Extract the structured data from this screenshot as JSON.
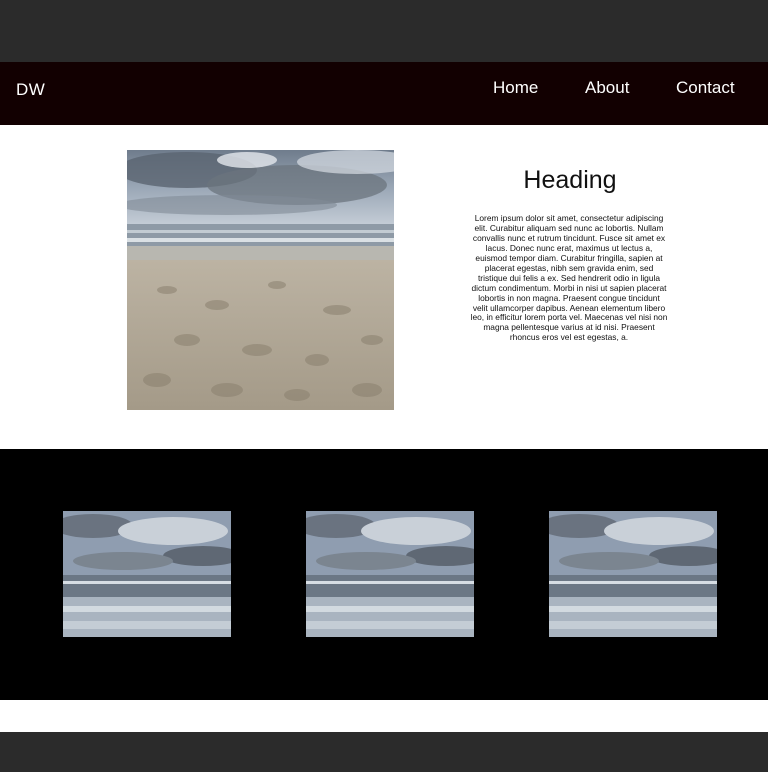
{
  "nav": {
    "logo": "DW",
    "links": [
      "Home",
      "About",
      "Contact"
    ]
  },
  "hero": {
    "heading": "Heading",
    "body": "Lorem ipsum dolor sit amet, consectetur adipiscing elit. Curabitur aliquam sed nunc ac lobortis. Nullam convallis nunc et rutrum tincidunt. Fusce sit amet ex lacus. Donec nunc erat, maximus ut lectus a, euismod tempor diam. Curabitur fringilla, sapien at placerat egestas, nibh sem gravida enim, sed tristique dui felis a ex. Sed hendrerit odio in ligula dictum condimentum. Morbi in nisi ut sapien placerat lobortis in non magna. Praesent congue tincidunt velit ullamcorper dapibus. Aenean elementum libero leo, in efficitur lorem porta vel. Maecenas vel nisi non magna pellentesque varius at id nisi. Praesent rhoncus eros vel est egestas, a."
  },
  "colors": {
    "nav_bg": "#120001",
    "page_bg": "#2b2b2b",
    "gallery_bg": "#000000"
  }
}
